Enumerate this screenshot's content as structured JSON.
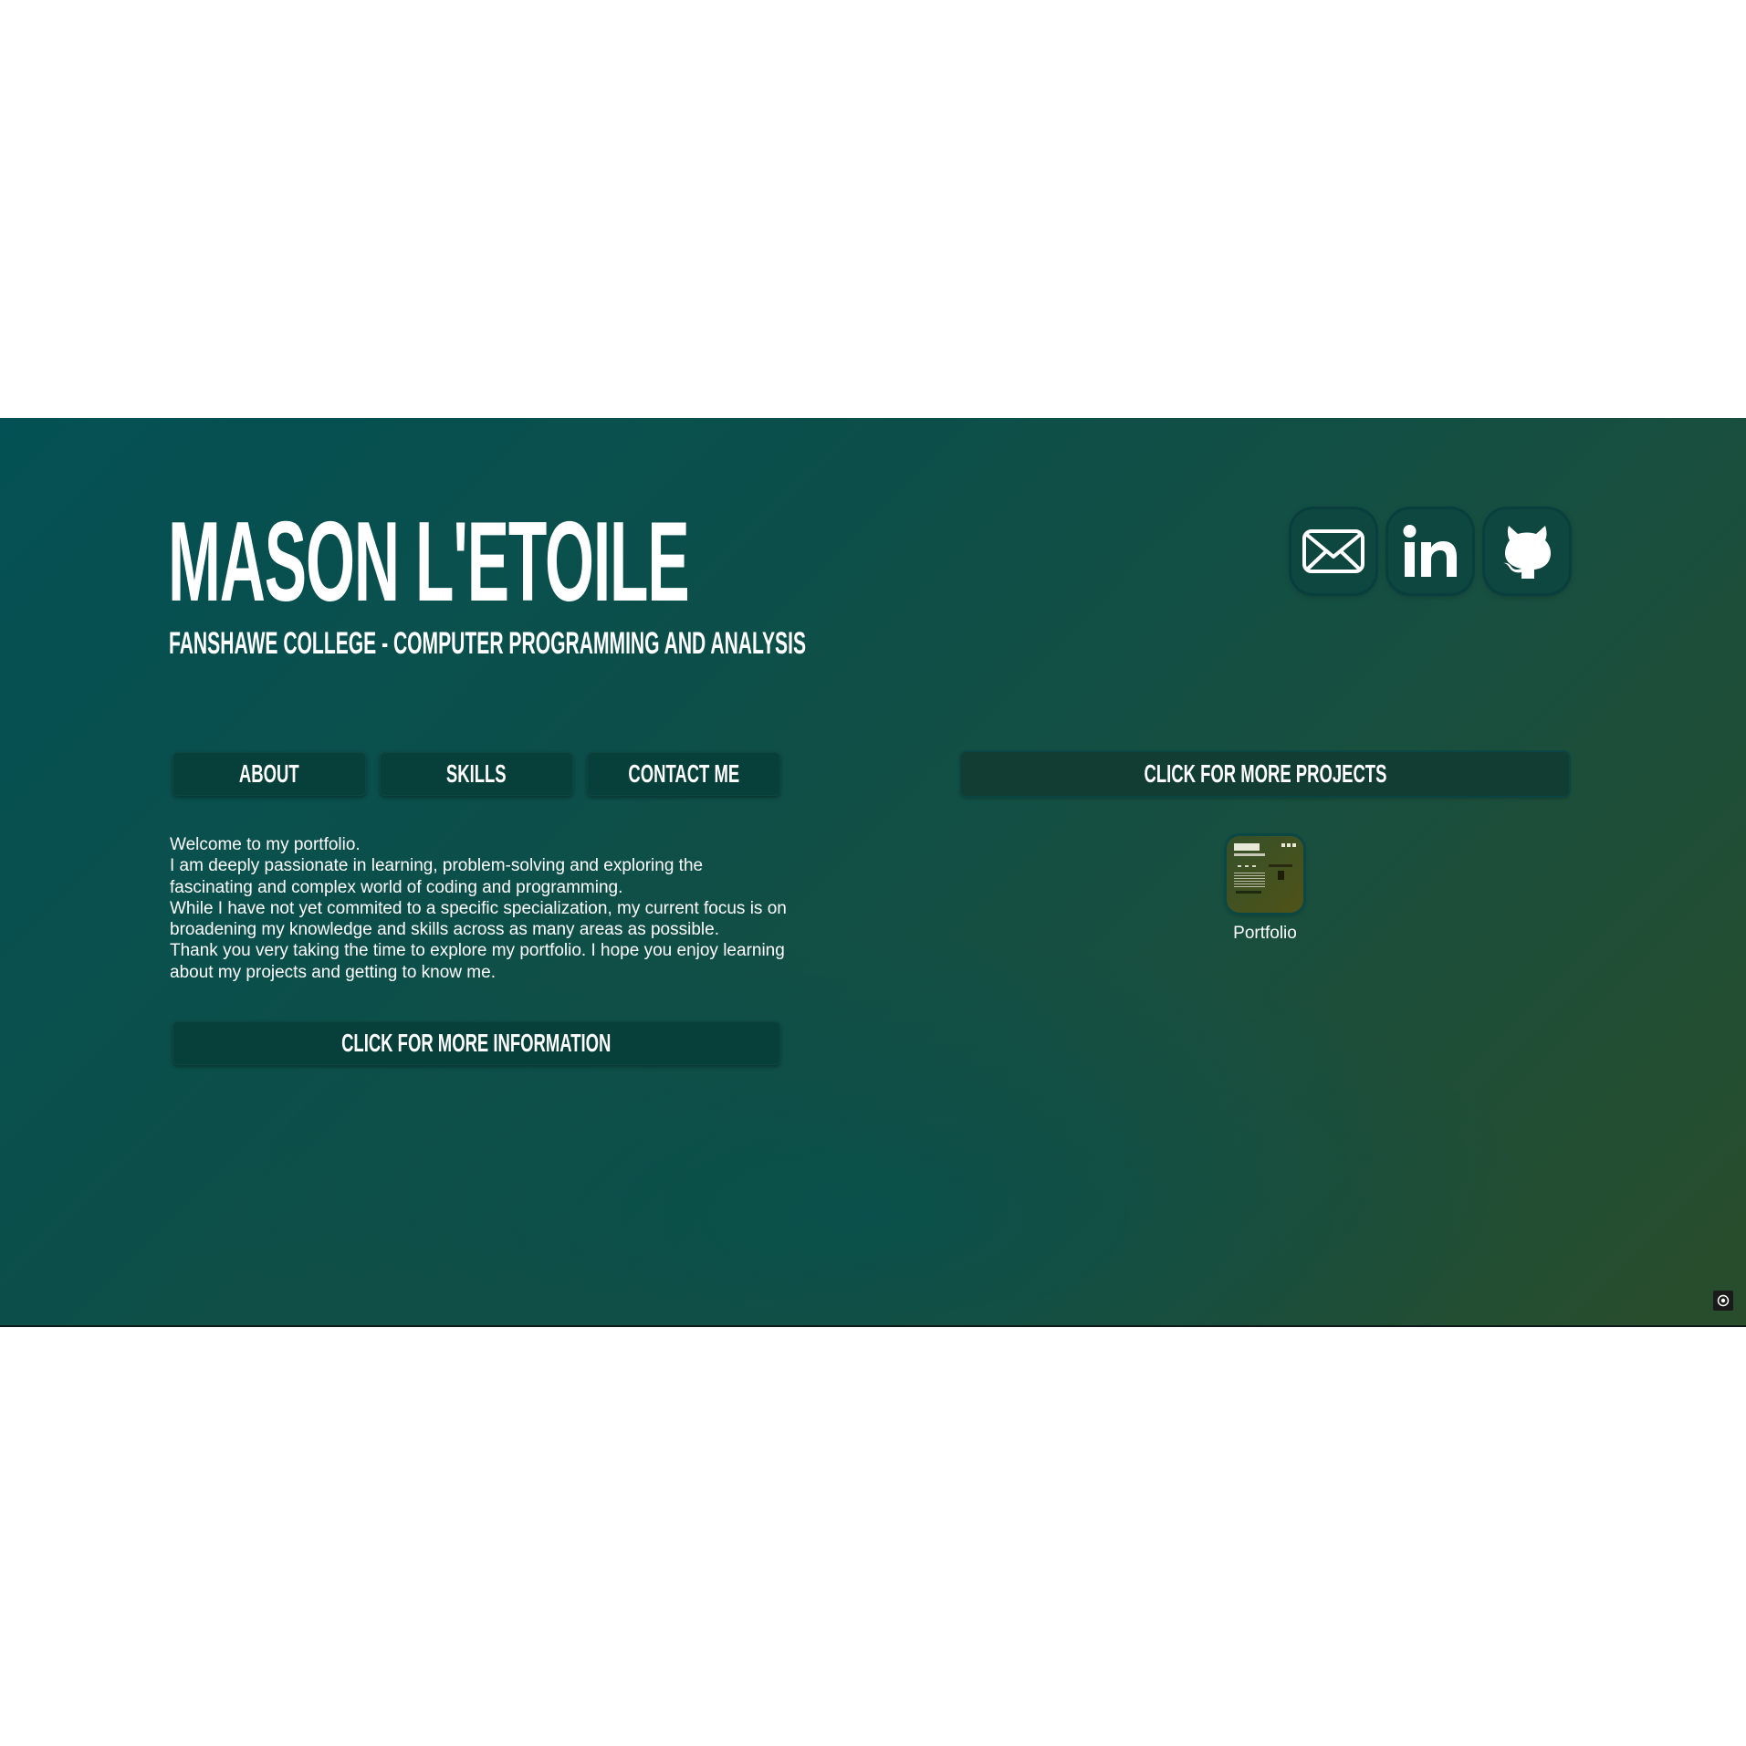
{
  "header": {
    "name": "MASON L'ETOILE",
    "subtitle": "FANSHAWE COLLEGE - COMPUTER PROGRAMMING AND ANALYSIS"
  },
  "social": [
    {
      "icon": "envelope-icon",
      "label": "Email"
    },
    {
      "icon": "linkedin-icon",
      "label": "LinkedIn"
    },
    {
      "icon": "github-icon",
      "label": "GitHub"
    }
  ],
  "nav": {
    "about": "ABOUT",
    "skills": "SKILLS",
    "contact": "CONTACT ME"
  },
  "about": {
    "lines": [
      "Welcome to my portfolio.",
      "I am deeply passionate in learning, problem-solving and exploring the fascinating and complex world of coding and programming.",
      "While I have not yet commited to a specific specialization, my current focus is on broadening my knowledge and skills across as many areas as possible.",
      "Thank you very taking the time to explore my portfolio. I hope you enjoy learning about my projects and getting to know me."
    ],
    "more_button": "CLICK FOR MORE INFORMATION"
  },
  "projects": {
    "more_button": "CLICK FOR MORE PROJECTS",
    "items": [
      {
        "label": "Portfolio"
      }
    ]
  },
  "colors": {
    "background_start": "#045155",
    "background_end": "#294d2b",
    "button": "#073f3a",
    "text": "#ffffff"
  }
}
